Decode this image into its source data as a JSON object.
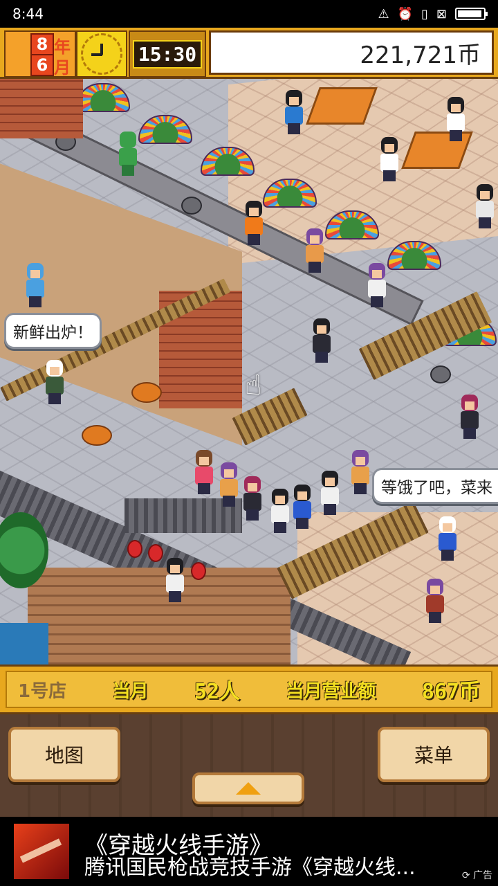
{
  "status_bar": {
    "time": "8:44",
    "icons": [
      "alert-icon",
      "alarm-icon",
      "vibrate-icon",
      "sim-icon",
      "battery-icon"
    ]
  },
  "hud": {
    "year_value": "8",
    "year_unit": "年",
    "month_value": "6",
    "month_unit": "月",
    "time": "15:30",
    "money": "221,721币"
  },
  "speech_bubbles": {
    "chef": "新鲜出炉！",
    "customer": "等饿了吧，菜来"
  },
  "info_bar": {
    "shop": "1号店",
    "month_label": "当月",
    "customers": "52人",
    "revenue_label": "当月营业额",
    "revenue": "867币"
  },
  "buttons": {
    "map": "地图",
    "menu": "菜单"
  },
  "ad": {
    "title": "《穿越火线手游》",
    "description": "腾讯国民枪战竞技手游《穿越火线...",
    "tag": "广告"
  },
  "colors": {
    "hud_gold": "#e8a81e",
    "hud_red": "#e8461e",
    "menu_brown": "#5a4030"
  }
}
